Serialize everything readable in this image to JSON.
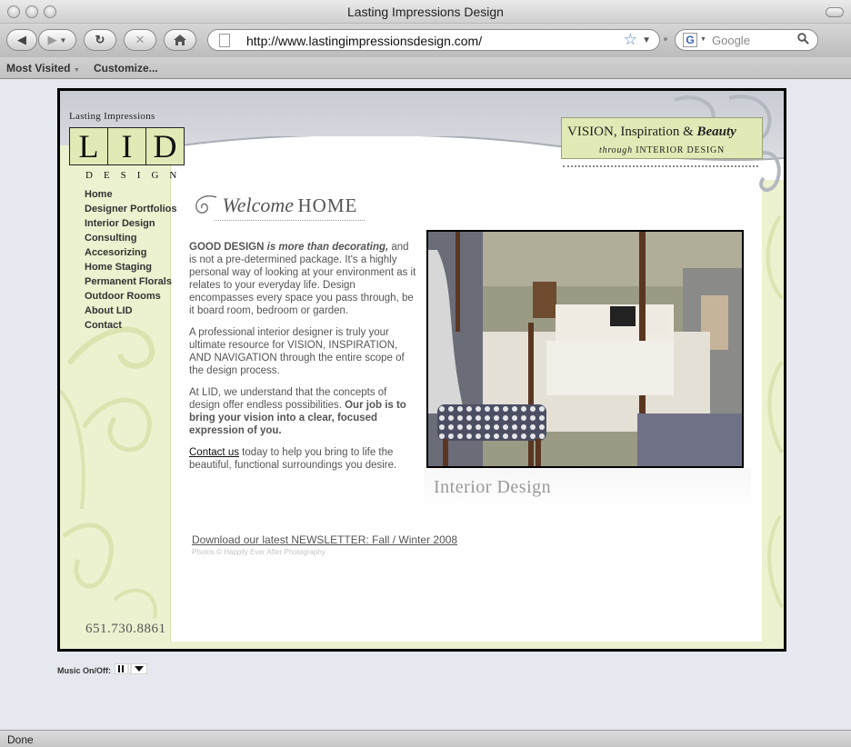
{
  "window": {
    "title": "Lasting Impressions Design"
  },
  "toolbar": {
    "url": "http://www.lastingimpressionsdesign.com/",
    "search_placeholder": "Google",
    "back_icon": "back-arrow-icon",
    "forward_icon": "forward-arrow-icon",
    "reload_icon": "reload-icon",
    "stop_icon": "stop-icon",
    "home_icon": "home-icon"
  },
  "bookmarks": {
    "most_visited": "Most Visited",
    "customize": "Customize..."
  },
  "status": {
    "text": "Done"
  },
  "site": {
    "logo": {
      "top_text": "Lasting Impressions",
      "letters": [
        "L",
        "I",
        "D"
      ],
      "design": "DESIGN"
    },
    "tagline": {
      "vision": "VISION,",
      "inspiration": " Inspiration & ",
      "beauty": "Beauty",
      "through": "through ",
      "interior_design": "INTERIOR DESIGN"
    },
    "nav": [
      "Home",
      "Designer Portfolios",
      "Interior Design",
      "Consulting",
      "Accesorizing",
      "Home Staging",
      "Permanent Florals",
      "Outdoor Rooms",
      "About LID",
      "Contact"
    ],
    "phone": "651.730.8861",
    "welcome": {
      "script": "Welcome",
      "home": "HOME"
    },
    "content": {
      "p1_bold": "GOOD DESIGN",
      "p1_italic": " is more than decorating,",
      "p1_rest": " and is not a pre-determined package. It's a highly personal way of looking at your environment as it relates to your everyday life. Design encompasses every space you pass through, be it board room, bedroom or garden.",
      "p2": "A professional interior designer is truly your ultimate resource for VISION, INSPIRATION, AND NAVIGATION through the entire scope of the design process.",
      "p3_start": "At LID, we understand that the concepts of design offer endless possibilities. ",
      "p3_bold": "Our job is to bring your vision into a clear, focused expression of you.",
      "p4_link": "Contact us",
      "p4_rest": " today to help you bring to life the beautiful, functional surroundings you desire."
    },
    "photo_caption": "Interior Design",
    "newsletter": "Download our latest NEWSLETTER: Fall / Winter 2008",
    "credit": "Photos © Happily Ever After Photography"
  },
  "music": {
    "label": "Music On/Off:"
  },
  "colors": {
    "accent_green": "#e1eab6",
    "side_green": "#ecf1cf",
    "header_gray": "#c9ccd3",
    "url_star": "#4d86cf"
  }
}
